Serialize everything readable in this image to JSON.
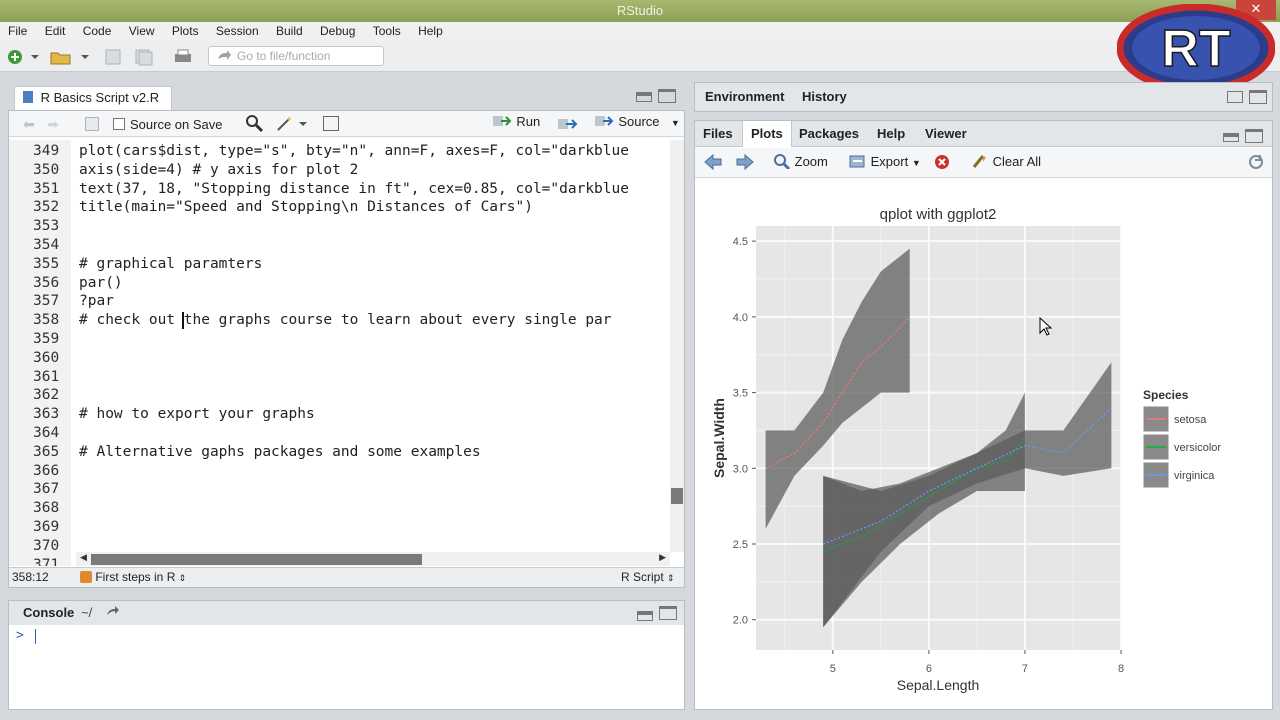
{
  "window": {
    "title": "RStudio",
    "minimize": "‒",
    "close": "✕"
  },
  "menu": [
    "File",
    "Edit",
    "Code",
    "View",
    "Plots",
    "Session",
    "Build",
    "Debug",
    "Tools",
    "Help"
  ],
  "toolbar": {
    "goto_placeholder": "Go to file/function"
  },
  "editor": {
    "tab_label": "R Basics Script v2.R",
    "source_on_save": "Source on Save",
    "run_label": "Run",
    "source_label": "Source",
    "lines": [
      {
        "n": "349",
        "text": "plot(cars$dist, type=\"s\", bty=\"n\", ann=F, axes=F, col=\"darkblue"
      },
      {
        "n": "350",
        "text": "axis(side=4) # y axis for plot 2"
      },
      {
        "n": "351",
        "text": "text(37, 18, \"Stopping distance in ft\", cex=0.85, col=\"darkblue"
      },
      {
        "n": "352",
        "text": "title(main=\"Speed and Stopping\\n Distances of Cars\")"
      },
      {
        "n": "353",
        "text": ""
      },
      {
        "n": "354",
        "text": ""
      },
      {
        "n": "355",
        "text": "# graphical paramters"
      },
      {
        "n": "356",
        "text": "par()"
      },
      {
        "n": "357",
        "text": "?par"
      },
      {
        "n": "358",
        "text": "# check out the graphs course to learn about every single par"
      },
      {
        "n": "359",
        "text": ""
      },
      {
        "n": "360",
        "text": ""
      },
      {
        "n": "361",
        "text": ""
      },
      {
        "n": "362",
        "text": ""
      },
      {
        "n": "363",
        "text": "# how to export your graphs"
      },
      {
        "n": "364",
        "text": ""
      },
      {
        "n": "365",
        "text": "# Alternative gaphs packages and some examples"
      },
      {
        "n": "366",
        "text": ""
      },
      {
        "n": "367",
        "text": ""
      },
      {
        "n": "368",
        "text": ""
      },
      {
        "n": "369",
        "text": ""
      },
      {
        "n": "370",
        "text": ""
      },
      {
        "n": "371",
        "text": ""
      }
    ],
    "status_position": "358:12",
    "status_scope": "First steps in R",
    "status_filetype": "R Script"
  },
  "console": {
    "title": "Console",
    "path": "~/",
    "prompt": ">"
  },
  "env_pane": {
    "tabs": [
      "Environment",
      "History"
    ]
  },
  "files_pane": {
    "tabs": [
      "Files",
      "Plots",
      "Packages",
      "Help",
      "Viewer"
    ],
    "active_tab": "Plots",
    "zoom_label": "Zoom",
    "export_label": "Export",
    "clear_label": "Clear All"
  },
  "logo_text": "RT",
  "chart_data": {
    "type": "line",
    "title": "qplot with ggplot2",
    "xlabel": "Sepal.Length",
    "ylabel": "Sepal.Width",
    "xlim": [
      4.2,
      8.0
    ],
    "ylim": [
      1.8,
      4.6
    ],
    "xticks": [
      "5",
      "6",
      "7",
      "8"
    ],
    "yticks": [
      "2.0",
      "2.5",
      "3.0",
      "3.5",
      "4.0",
      "4.5"
    ],
    "legend": {
      "title": "Species",
      "position": "right"
    },
    "grid": true,
    "series": [
      {
        "name": "setosa",
        "color": "#f8766d",
        "x": [
          4.3,
          4.6,
          4.9,
          5.1,
          5.3,
          5.5,
          5.8
        ],
        "y": [
          3.0,
          3.1,
          3.3,
          3.5,
          3.7,
          3.8,
          4.0
        ],
        "upper": [
          3.25,
          3.25,
          3.5,
          3.85,
          4.1,
          4.3,
          4.45
        ],
        "lower": [
          2.6,
          2.95,
          3.15,
          3.3,
          3.4,
          3.5,
          3.5
        ]
      },
      {
        "name": "versicolor",
        "color": "#00ba38",
        "x": [
          4.9,
          5.3,
          5.7,
          6.1,
          6.5,
          6.8,
          7.0
        ],
        "y": [
          2.45,
          2.55,
          2.7,
          2.85,
          3.0,
          3.05,
          3.2
        ],
        "upper": [
          2.95,
          2.85,
          2.9,
          3.0,
          3.1,
          3.25,
          3.5
        ],
        "lower": [
          1.95,
          2.25,
          2.5,
          2.7,
          2.85,
          2.85,
          2.85
        ]
      },
      {
        "name": "virginica",
        "color": "#619cff",
        "x": [
          4.9,
          5.5,
          6.0,
          6.5,
          7.0,
          7.4,
          7.9
        ],
        "y": [
          2.5,
          2.65,
          2.85,
          3.0,
          3.15,
          3.1,
          3.4
        ],
        "upper": [
          2.95,
          2.85,
          2.95,
          3.1,
          3.25,
          3.25,
          3.7
        ],
        "lower": [
          1.95,
          2.45,
          2.75,
          2.9,
          3.0,
          2.95,
          3.0
        ]
      }
    ]
  }
}
